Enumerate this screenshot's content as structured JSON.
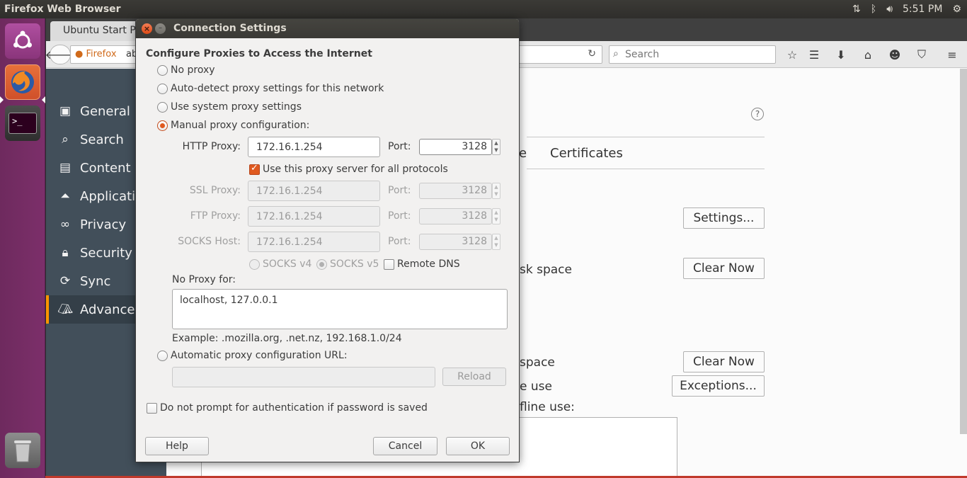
{
  "top_panel": {
    "title": "Firefox Web Browser",
    "time": "5:51 PM",
    "icons": [
      "network-arrows-icon",
      "bluetooth-icon",
      "volume-icon",
      "gear-icon"
    ]
  },
  "launcher": {
    "items": [
      "ubuntu-dash-icon",
      "firefox-icon",
      "terminal-icon",
      "trash-icon"
    ]
  },
  "browser": {
    "tab_title": "Ubuntu Start P",
    "identity_label": "Firefox",
    "url_partial": "ab",
    "search_placeholder": "Search"
  },
  "prefs": {
    "categories": [
      {
        "label": "General",
        "icon": "general-icon"
      },
      {
        "label": "Search",
        "icon": "search-icon"
      },
      {
        "label": "Content",
        "icon": "content-icon"
      },
      {
        "label": "Applicati",
        "icon": "applications-icon"
      },
      {
        "label": "Privacy",
        "icon": "privacy-mask-icon"
      },
      {
        "label": "Security",
        "icon": "lock-icon"
      },
      {
        "label": "Sync",
        "icon": "sync-icon"
      },
      {
        "label": "Advanced",
        "icon": "advanced-wizard-icon"
      }
    ],
    "selected_category": "Advanced",
    "tab_partial": "e",
    "tab_certificates": "Certificates",
    "settings_button": "Settings...",
    "disk_space_text": "sk space",
    "clear_now_1": "Clear Now",
    "disk_space_text_2": "space",
    "clear_now_2": "Clear Now",
    "e_use_text": "e use",
    "exceptions_button": "Exceptions...",
    "offline_use_text": "fline use:"
  },
  "dialog": {
    "title": "Connection Settings",
    "heading": "Configure Proxies to Access the Internet",
    "options": {
      "no_proxy": "No proxy",
      "auto_detect": "Auto-detect proxy settings for this network",
      "system": "Use system proxy settings",
      "manual": "Manual proxy configuration:",
      "auto_url": "Automatic proxy configuration URL:"
    },
    "selected_option": "manual",
    "http_proxy_label": "HTTP Proxy:",
    "http_proxy_value": "172.16.1.254",
    "port_label": "Port:",
    "http_port": "3128",
    "use_for_all_label": "Use this proxy server for all protocols",
    "use_for_all_checked": true,
    "ssl_proxy_label": "SSL Proxy:",
    "ssl_proxy_value": "172.16.1.254",
    "ssl_port": "3128",
    "ftp_proxy_label": "FTP Proxy:",
    "ftp_proxy_value": "172.16.1.254",
    "ftp_port": "3128",
    "socks_host_label": "SOCKS Host:",
    "socks_host_value": "172.16.1.254",
    "socks_port": "3128",
    "socks_v4": "SOCKS v4",
    "socks_v5": "SOCKS v5",
    "remote_dns": "Remote DNS",
    "no_proxy_for_label": "No Proxy for:",
    "no_proxy_for_value": "localhost, 127.0.0.1",
    "example": "Example: .mozilla.org, .net.nz, 192.168.1.0/24",
    "auto_url_value": "",
    "reload_button": "Reload",
    "no_prompt_auth": "Do not prompt for authentication if password is saved",
    "help_button": "Help",
    "cancel_button": "Cancel",
    "ok_button": "OK"
  }
}
